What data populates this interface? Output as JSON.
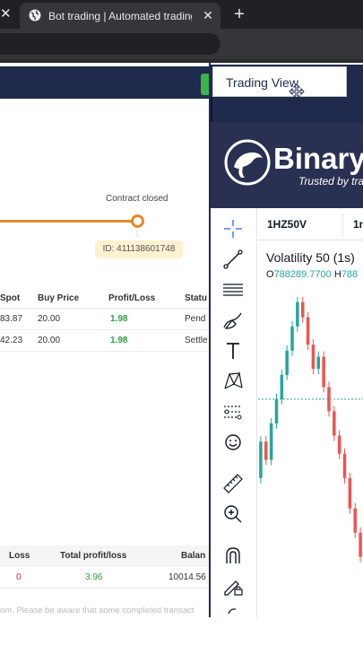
{
  "browser": {
    "tab_title": "Bot trading | Automated trading",
    "close_glyph": "✕",
    "new_tab_glyph": "+"
  },
  "bot_page": {
    "contract_status": "Contract closed",
    "contract_id": "ID: 411138601748",
    "table": {
      "headers": [
        "Spot",
        "Buy Price",
        "Profit/Loss",
        "Statu"
      ],
      "rows": [
        {
          "spot": "83.87",
          "buy_price": "20.00",
          "profit_loss": "1.98",
          "status": "Pend"
        },
        {
          "spot": "42.23",
          "buy_price": "20.00",
          "profit_loss": "1.98",
          "status": "Settle"
        }
      ]
    },
    "summary": {
      "headers": [
        "Loss",
        "Total profit/loss",
        "Balan"
      ],
      "values": [
        "0",
        "3.96",
        "10014.56"
      ]
    },
    "note": "om. Please be aware that some completed transact"
  },
  "trading_view": {
    "title": "Trading View",
    "brand_name": "Binary.",
    "brand_tagline": "Trusted by traders",
    "symbol": "1HZ50V",
    "timeframe": "1n",
    "legend_title": "Volatility 50 (1s)",
    "ohlc": {
      "o_label": "O",
      "o_value": "788289.7700",
      "h_label": "H",
      "h_value": "788"
    },
    "tools": [
      "crosshair-icon",
      "trend-line-icon",
      "horizontal-lines-icon",
      "brush-icon",
      "text-icon",
      "pattern-icon",
      "prediction-icon",
      "emoji-icon",
      "ruler-icon",
      "zoom-in-icon",
      "magnet-icon",
      "lock-pencil-icon",
      "more-tools-icon"
    ]
  },
  "chart_data": {
    "type": "candlestick",
    "candles": [
      {
        "o": 40,
        "c": 52
      },
      {
        "o": 52,
        "c": 46
      },
      {
        "o": 46,
        "c": 58
      },
      {
        "o": 58,
        "c": 66
      },
      {
        "o": 66,
        "c": 74
      },
      {
        "o": 74,
        "c": 82
      },
      {
        "o": 82,
        "c": 90
      },
      {
        "o": 90,
        "c": 98
      },
      {
        "o": 98,
        "c": 93
      },
      {
        "o": 93,
        "c": 84
      },
      {
        "o": 84,
        "c": 76
      },
      {
        "o": 76,
        "c": 80
      },
      {
        "o": 80,
        "c": 70
      },
      {
        "o": 70,
        "c": 62
      },
      {
        "o": 62,
        "c": 54
      },
      {
        "o": 54,
        "c": 48
      },
      {
        "o": 48,
        "c": 40
      },
      {
        "o": 40,
        "c": 30
      },
      {
        "o": 30,
        "c": 22
      },
      {
        "o": 22,
        "c": 14
      }
    ],
    "ref_level": 66
  },
  "colors": {
    "navy": "#1f2a4d",
    "accent_orange": "#e08a2b",
    "profit_green": "#2e9e41",
    "loss_red": "#d9342b",
    "candle_up": "#26a69a",
    "candle_down": "#ef5350"
  }
}
